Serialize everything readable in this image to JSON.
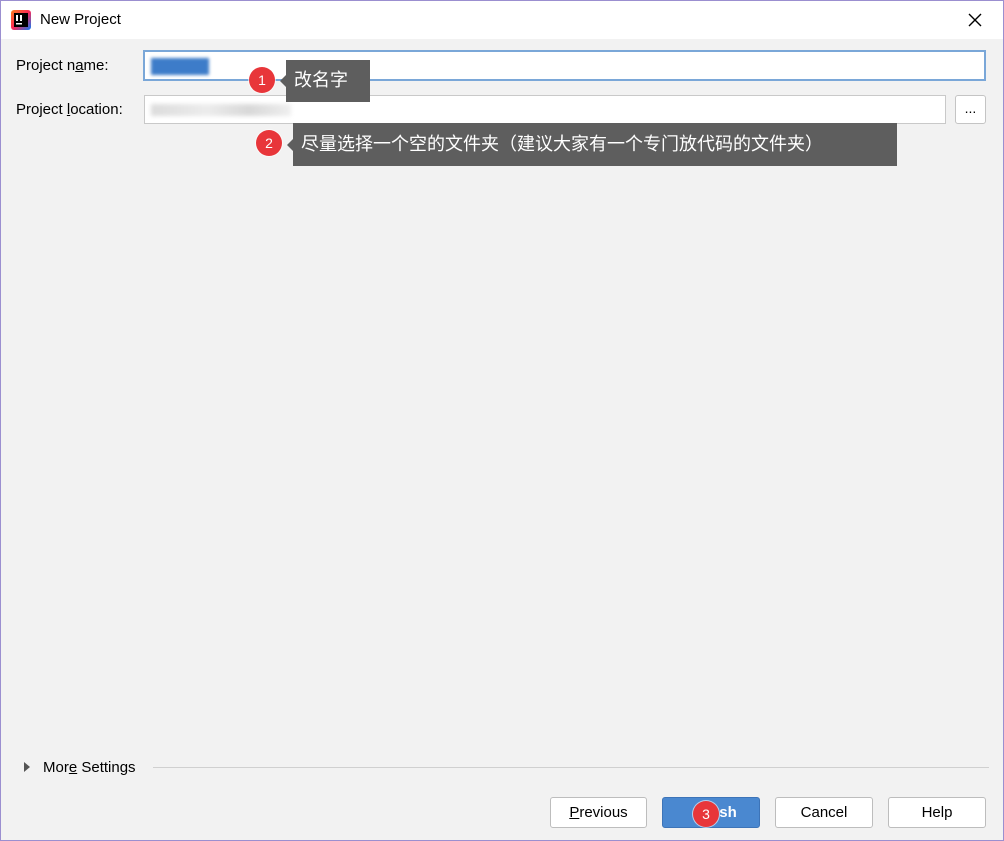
{
  "window": {
    "title": "New Project",
    "accent_color": "#4a88d0"
  },
  "form": {
    "project_name": {
      "label_before": "Project n",
      "label_mnemonic": "a",
      "label_after": "me:"
    },
    "project_location": {
      "label_before": "Project ",
      "label_mnemonic": "l",
      "label_after": "ocation:",
      "browse_label": "..."
    }
  },
  "annotations": [
    {
      "number": "1",
      "text": "改名字"
    },
    {
      "number": "2",
      "text": "尽量选择一个空的文件夹（建议大家有一个专门放代码的文件夹）"
    },
    {
      "number": "3"
    }
  ],
  "more_settings": {
    "label_before": "Mor",
    "label_mnemonic": "e",
    "label_after": " Settings"
  },
  "buttons": {
    "previous": {
      "mnemonic": "P",
      "rest": "revious"
    },
    "finish": {
      "visible_tail": "sh"
    },
    "cancel": "Cancel",
    "help": "Help"
  }
}
